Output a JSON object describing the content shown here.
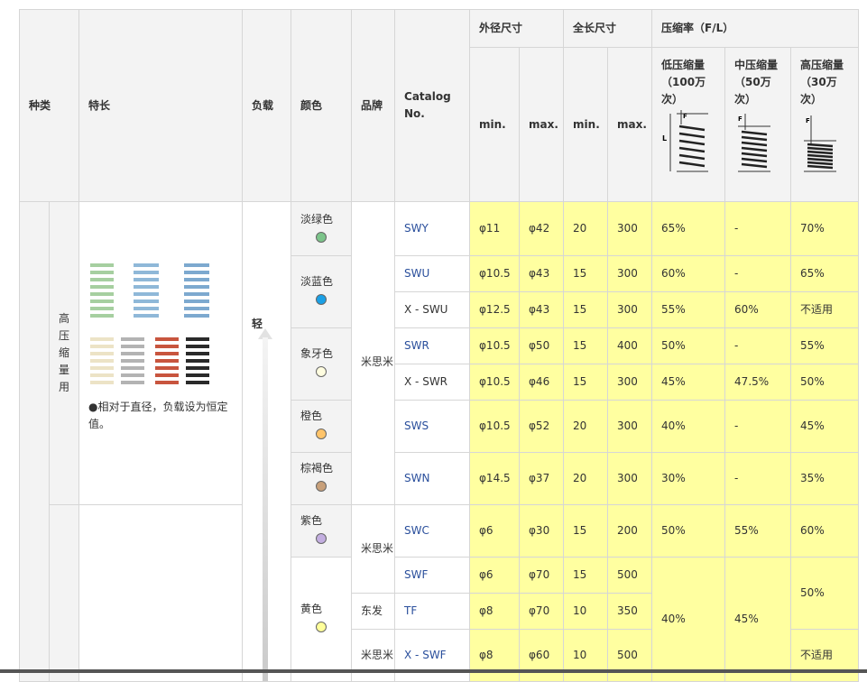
{
  "headers": {
    "type": "种类",
    "feature": "特长",
    "load": "负载",
    "color": "颜色",
    "brand": "品牌",
    "catalog": "Catalog No.",
    "outer_dia": "外径尺寸",
    "length": "全长尺寸",
    "compression": "压缩率（F/L）",
    "min": "min.",
    "max": "max.",
    "low": "低压缩量（100万次）",
    "mid": "中压缩量（50万次）",
    "high": "高压缩量（30万次）",
    "diagram_F": "F",
    "diagram_L": "L"
  },
  "group1": {
    "type": "高压缩量用",
    "feature_note": "●相对于直径，负载设为恒定值。",
    "load": "轻",
    "brand": "米思米"
  },
  "colors": {
    "light_green": "淡绿色",
    "light_blue": "淡蓝色",
    "ivory": "象牙色",
    "orange": "橙色",
    "brown": "棕褐色",
    "purple": "紫色",
    "yellow": "黄色"
  },
  "brands": {
    "misumi": "米思米",
    "tohatsu": "东发"
  },
  "rows": [
    {
      "catalog": "SWY",
      "od_min": "φ11",
      "od_max": "φ42",
      "len_min": "20",
      "len_max": "300",
      "low": "65%",
      "mid": "-",
      "high": "70%"
    },
    {
      "catalog": "SWU",
      "od_min": "φ10.5",
      "od_max": "φ43",
      "len_min": "15",
      "len_max": "300",
      "low": "60%",
      "mid": "-",
      "high": "65%"
    },
    {
      "catalog": "X - SWU",
      "od_min": "φ12.5",
      "od_max": "φ43",
      "len_min": "15",
      "len_max": "300",
      "low": "55%",
      "mid": "60%",
      "high": "不适用"
    },
    {
      "catalog": "SWR",
      "od_min": "φ10.5",
      "od_max": "φ50",
      "len_min": "15",
      "len_max": "400",
      "low": "50%",
      "mid": "-",
      "high": "55%"
    },
    {
      "catalog": "X - SWR",
      "od_min": "φ10.5",
      "od_max": "φ46",
      "len_min": "15",
      "len_max": "300",
      "low": "45%",
      "mid": "47.5%",
      "high": "50%"
    },
    {
      "catalog": "SWS",
      "od_min": "φ10.5",
      "od_max": "φ52",
      "len_min": "20",
      "len_max": "300",
      "low": "40%",
      "mid": "-",
      "high": "45%"
    },
    {
      "catalog": "SWN",
      "od_min": "φ14.5",
      "od_max": "φ37",
      "len_min": "20",
      "len_max": "300",
      "low": "30%",
      "mid": "-",
      "high": "35%"
    },
    {
      "catalog": "SWC",
      "od_min": "φ6",
      "od_max": "φ30",
      "len_min": "15",
      "len_max": "200",
      "low": "50%",
      "mid": "55%",
      "high": "60%"
    },
    {
      "catalog": "SWF",
      "od_min": "φ6",
      "od_max": "φ70",
      "len_min": "15",
      "len_max": "500"
    },
    {
      "catalog": "TF",
      "od_min": "φ8",
      "od_max": "φ70",
      "len_min": "10",
      "len_max": "350"
    },
    {
      "catalog": "X - SWF",
      "od_min": "φ8",
      "od_max": "φ60",
      "len_min": "10",
      "len_max": "500",
      "high": "不适用"
    }
  ],
  "merged": {
    "low_yellow": "40%",
    "mid_yellow": "45%",
    "high_yellow": "50%"
  },
  "palette": {
    "light_green": "#7cc48a",
    "light_blue": "#1aa0e6",
    "ivory": "#fffde0",
    "orange": "#ffc46a",
    "brown": "#c8a07a",
    "purple": "#c3aee0",
    "yellow": "#ffff9a",
    "highlight": "#ffffa0"
  }
}
